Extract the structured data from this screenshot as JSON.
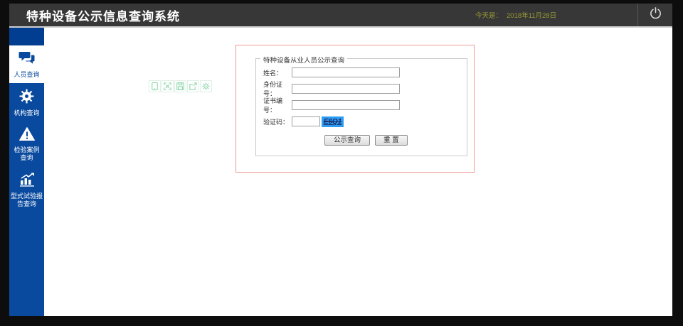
{
  "header": {
    "title": "特种设备公示信息查询系统",
    "date_label": "今天是：",
    "date_value": "2018年11月28日"
  },
  "sidebar": {
    "items": [
      {
        "label": "人员查询",
        "icon": "comments-icon",
        "active": true
      },
      {
        "label": "机构查询",
        "icon": "gear-icon",
        "active": false
      },
      {
        "label": "检验案例\n查询",
        "icon": "warning-icon",
        "active": false
      },
      {
        "label": "型式试验报\n告查询",
        "icon": "chart-icon",
        "active": false
      }
    ]
  },
  "toolbar": {
    "icons": [
      "device-icon",
      "fullscreen-icon",
      "save-icon",
      "external-link-icon",
      "settings-icon"
    ]
  },
  "form": {
    "legend": "特种设备从业人员公示查询",
    "fields": [
      {
        "label": "姓名：",
        "value": ""
      },
      {
        "label": "身份证号：",
        "value": ""
      },
      {
        "label": "证书编号：",
        "value": ""
      }
    ],
    "captcha": {
      "label": "验证码：",
      "value": "",
      "code": "E6Q1"
    },
    "buttons": {
      "submit": "公示查询",
      "reset": "重 置"
    }
  },
  "colors": {
    "sidebar_blue": "#0a4a9e",
    "sidebar_top_blue": "#013d90",
    "header_gray": "#373737",
    "date_olive": "#9a9b35",
    "captcha_bg": "#2d9cf4",
    "box_border_red": "#f09a97",
    "toolbar_icon_mint": "#8fd8ab"
  }
}
